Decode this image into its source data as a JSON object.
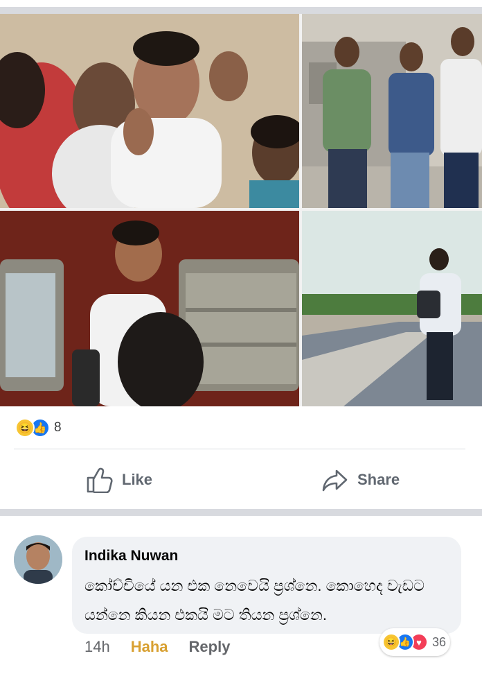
{
  "post": {
    "photos": [
      {
        "name": "photo-crowd-greeting"
      },
      {
        "name": "photo-platform-group"
      },
      {
        "name": "photo-train-window"
      },
      {
        "name": "photo-walking-platform"
      }
    ],
    "reactions": {
      "icons": [
        "haha-icon",
        "like-icon"
      ],
      "count": "8"
    },
    "actions": {
      "like_label": "Like",
      "share_label": "Share"
    }
  },
  "comment": {
    "author": "Indika Nuwan",
    "text": "කෝච්චියේ යන එක නෙවෙයි ප්‍රශ්නෙ. කොහෙද වැඩට යන්නෙ කියන එකයි මට තියන ප්‍රශ්නෙ.",
    "time": "14h",
    "haha_label": "Haha",
    "reply_label": "Reply",
    "reactions": {
      "icons": [
        "haha-icon",
        "like-icon",
        "love-icon"
      ],
      "count": "36"
    }
  },
  "colors": {
    "facebook_blue": "#1877f2",
    "haha_yellow": "#f7c533",
    "love_red": "#f33e58",
    "haha_text": "#d8a031",
    "muted_text": "#65676b"
  }
}
